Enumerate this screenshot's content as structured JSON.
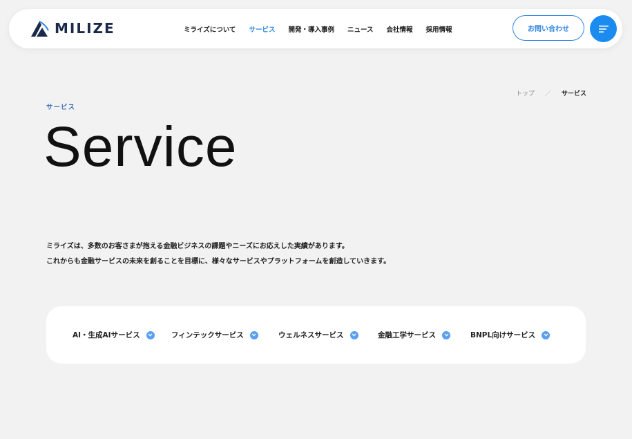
{
  "header": {
    "logo_text": "MILIZE",
    "nav": [
      {
        "label": "ミライズについて"
      },
      {
        "label": "サービス"
      },
      {
        "label": "開発・導入事例"
      },
      {
        "label": "ニュース"
      },
      {
        "label": "会社情報"
      },
      {
        "label": "採用情報"
      }
    ],
    "active_nav": "サービス",
    "contact_label": "お問い合わせ",
    "menu_icon": "menu-lines-icon"
  },
  "breadcrumb": {
    "top": "トップ",
    "separator": "／",
    "current": "サービス"
  },
  "hero": {
    "eyebrow": "サービス",
    "title": "Service"
  },
  "lead": {
    "line1": "ミライズは、多数のお客さまが抱える金融ビジネスの課題やニーズにお応えした実績があります。",
    "line2": "これからも金融サービスの未来を創ることを目標に、様々なサービスやプラットフォームを創造していきます。"
  },
  "services": [
    {
      "label": "AI・生成AIサービス"
    },
    {
      "label": "フィンテックサービス"
    },
    {
      "label": "ウェルネスサービス"
    },
    {
      "label": "金融工学サービス"
    },
    {
      "label": "BNPL向けサービス"
    }
  ],
  "colors": {
    "accent": "#2f84e2",
    "menu_button": "#1b8bf0",
    "chevron": "#5a9ff0",
    "eyebrow": "#3d6db5",
    "background": "#f2f2f2",
    "logo": "#1b2a4a"
  }
}
